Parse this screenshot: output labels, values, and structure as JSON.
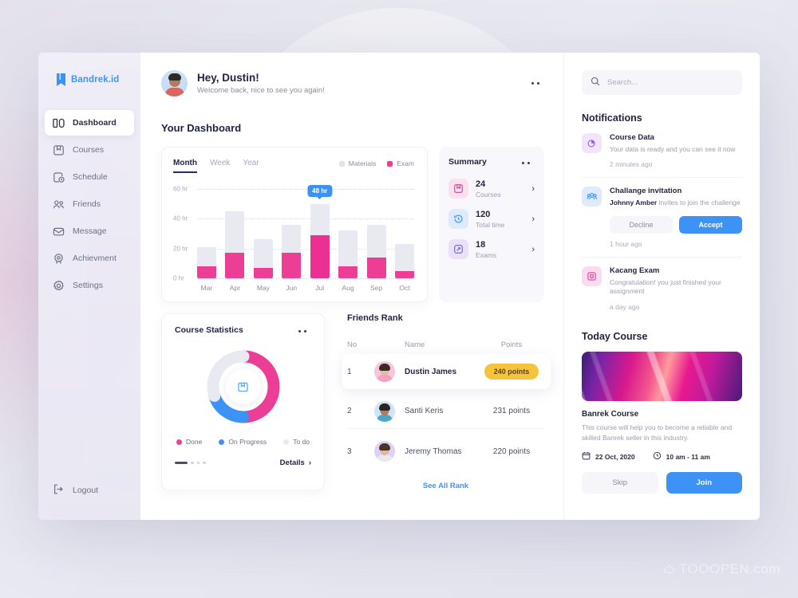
{
  "brand": {
    "name": "Bandrek.id",
    "icon": "book-icon"
  },
  "sidebar": {
    "items": [
      {
        "label": "Dashboard",
        "icon": "dashboard-icon",
        "active": true
      },
      {
        "label": "Courses",
        "icon": "book-icon",
        "active": false
      },
      {
        "label": "Schedule",
        "icon": "calendar-clock-icon",
        "active": false
      },
      {
        "label": "Friends",
        "icon": "people-icon",
        "active": false
      },
      {
        "label": "Message",
        "icon": "envelope-icon",
        "active": false
      },
      {
        "label": "Achievment",
        "icon": "medal-icon",
        "active": false
      },
      {
        "label": "Settings",
        "icon": "gear-icon",
        "active": false
      }
    ],
    "logout": {
      "label": "Logout",
      "icon": "logout-icon"
    }
  },
  "header": {
    "greeting": "Hey, Dustin!",
    "subtitle": "Welcome back, nice to see you again!",
    "menu_icon": "more-dots-icon"
  },
  "dashboard": {
    "title": "Your Dashboard"
  },
  "chart_data": {
    "type": "bar",
    "title": "",
    "xlabel": "",
    "ylabel": "hr",
    "stacked": true,
    "grid": true,
    "ylim": [
      0,
      60
    ],
    "ytick_labels": [
      "0 hr",
      "20 hr",
      "40 hr",
      "60 hr"
    ],
    "yticks": [
      0,
      20,
      40,
      60
    ],
    "categories": [
      "Mar",
      "Apr",
      "May",
      "Jun",
      "Jul",
      "Aug",
      "Sep",
      "Oct"
    ],
    "series": [
      {
        "name": "Exam",
        "color": "#ed3e96",
        "values": [
          8,
          17,
          7,
          17,
          29,
          8,
          14,
          5
        ]
      },
      {
        "name": "Materials",
        "color": "#e9eaf1",
        "values": [
          13,
          28,
          19,
          19,
          21,
          24,
          22,
          18
        ]
      }
    ],
    "totals": [
      21,
      45,
      26,
      36,
      50,
      32,
      36,
      23
    ],
    "highlight": {
      "category": "Jul",
      "label": "48 hr",
      "color": "#3d93f5"
    },
    "legend": [
      {
        "label": "Materials",
        "color": "#e2e3ec"
      },
      {
        "label": "Exam",
        "color": "#ed3e96"
      }
    ],
    "tabs": [
      {
        "label": "Month",
        "active": true
      },
      {
        "label": "Week",
        "active": false
      },
      {
        "label": "Year",
        "active": false
      }
    ]
  },
  "summary": {
    "title": "Summary",
    "menu_icon": "more-dots-icon",
    "items": [
      {
        "value": "24",
        "label": "Courses",
        "icon": "book-icon",
        "bg": "#fbe1f0",
        "fg": "#e3399a"
      },
      {
        "value": "120",
        "label": "Total time",
        "icon": "history-clock-icon",
        "bg": "#dfeafd",
        "fg": "#3d93f5"
      },
      {
        "value": "18",
        "label": "Exams",
        "icon": "pen-square-icon",
        "bg": "#e8e1f9",
        "fg": "#7b5ad6"
      }
    ]
  },
  "course_statistics": {
    "title": "Course Statistics",
    "menu_icon": "more-dots-icon",
    "center_icon": "book-icon",
    "chart": {
      "type": "pie",
      "slices": [
        {
          "label": "Done",
          "value": 50,
          "color": "#ed3e96"
        },
        {
          "label": "On Progress",
          "value": 20,
          "color": "#3d93f5"
        },
        {
          "label": "To do",
          "value": 30,
          "color": "#e9eaf1"
        }
      ]
    },
    "pages": 4,
    "active_page": 1,
    "details_label": "Details"
  },
  "friends_rank": {
    "title": "Friends Rank",
    "columns": [
      "No",
      "Name",
      "Points"
    ],
    "rows": [
      {
        "no": "1",
        "name": "Dustin James",
        "points": "240 points",
        "badge": true,
        "avatar_hair": "#3a2a24",
        "avatar_bg": "#f7c6dd",
        "avatar_skin": "#e8b9a0",
        "avatar_body": "#f2a0c4"
      },
      {
        "no": "2",
        "name": "Santi Keris",
        "points": "231 points",
        "badge": false,
        "avatar_hair": "#2b2623",
        "avatar_bg": "#cfe4fb",
        "avatar_skin": "#b2795a",
        "avatar_body": "#4aa6c9"
      },
      {
        "no": "3",
        "name": "Jeremy Thomas",
        "points": "220 points",
        "badge": false,
        "avatar_hair": "#4a3426",
        "avatar_bg": "#ddd2f6",
        "avatar_skin": "#e3b697",
        "avatar_body": "#e7e9ef"
      }
    ],
    "see_all_label": "See All Rank",
    "badge_color": "#f5c33c"
  },
  "search": {
    "placeholder": "Search...",
    "value": "",
    "icon": "search-icon"
  },
  "notifications": {
    "title": "Notifications",
    "items": [
      {
        "icon": "pie-chart-icon",
        "icon_bg": "#f2e4fa",
        "icon_fg": "#a05ad6",
        "title": "Course Data",
        "desc": "Your data is ready and you can see it now",
        "time": "2 minutes ago"
      },
      {
        "icon": "people-group-icon",
        "icon_bg": "#dfeafd",
        "icon_fg": "#3d93f5",
        "title": "Challange invitation",
        "desc_bold": "Johnny Amber",
        "desc": " invites to join the challenge",
        "time": "1 hour ago",
        "decline_label": "Decline",
        "accept_label": "Accept"
      },
      {
        "icon": "exam-square-icon",
        "icon_bg": "#fbdcee",
        "icon_fg": "#e3399a",
        "title": "Kacang Exam",
        "desc": "Congratulation! you just finished your assignment",
        "time": "a day ago"
      }
    ]
  },
  "today_course": {
    "title": "Today Course",
    "name": "Banrek Course",
    "description": "This course will help you to become a reliable and skilled Banrek seller in this industry.",
    "date": "22 Oct, 2020",
    "date_icon": "calendar-icon",
    "time": "10 am - 11 am",
    "time_icon": "clock-icon",
    "skip_label": "Skip",
    "join_label": "Join"
  },
  "watermark": {
    "text": "TOOOPEN.com"
  },
  "colors": {
    "accent_blue": "#3d93f5",
    "accent_pink": "#ed3e96",
    "badge_yellow": "#f5c33c",
    "text_dark": "#1f2340",
    "text_muted": "#9a9cb0"
  }
}
